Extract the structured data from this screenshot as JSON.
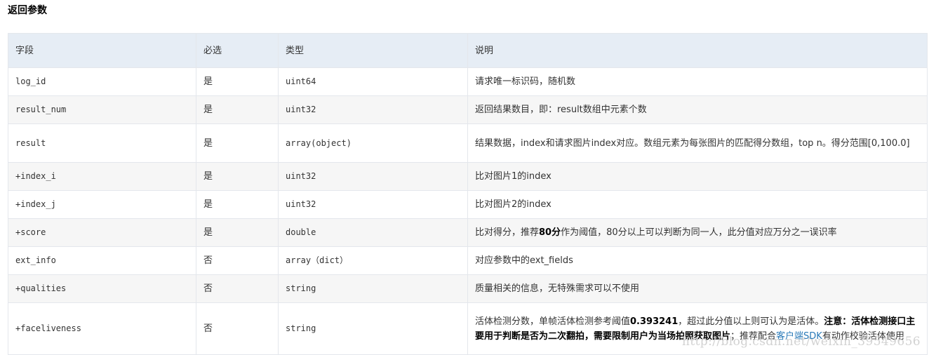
{
  "heading": "返回参数",
  "columns": [
    "字段",
    "必选",
    "类型",
    "说明"
  ],
  "rows": [
    {
      "field": "log_id",
      "required": "是",
      "type": "uint64",
      "desc": "请求唯一标识码，随机数"
    },
    {
      "field": "result_num",
      "required": "是",
      "type": "uint32",
      "desc": "返回结果数目，即：result数组中元素个数"
    },
    {
      "field": "result",
      "required": "是",
      "type": "array(object)",
      "desc": "结果数据，index和请求图片index对应。数组元素为每张图片的匹配得分数组，top n。得分范围[0,100.0]"
    },
    {
      "field": "+index_i",
      "required": "是",
      "type": "uint32",
      "desc": "比对图片1的index"
    },
    {
      "field": "+index_j",
      "required": "是",
      "type": "uint32",
      "desc": "比对图片2的index"
    },
    {
      "field": "+score",
      "required": "是",
      "type": "double",
      "desc_parts": [
        "比对得分，推荐",
        "80分",
        "作为阈值，80分以上可以判断为同一人，此分值对应万分之一误识率"
      ]
    },
    {
      "field": "ext_info",
      "required": "否",
      "type": "array（dict）",
      "desc": "对应参数中的ext_fields"
    },
    {
      "field": "+qualities",
      "required": "否",
      "type": "string",
      "desc": "质量相关的信息，无特殊需求可以不使用"
    },
    {
      "field": "+faceliveness",
      "required": "否",
      "type": "string",
      "desc_parts": [
        "活体检测分数，单帧活体检测参考阈值",
        "0.393241",
        "，超过此分值以上则可认为是活体。",
        "注意：活体检测接口主要用于判断是否为二次翻拍，需要限制用户为当场拍照获取图片",
        "；推荐配合",
        "客户端SDK",
        "有动作校验活体使用"
      ]
    }
  ],
  "watermark": "http://blog.csdn.net/weixin_39549656"
}
